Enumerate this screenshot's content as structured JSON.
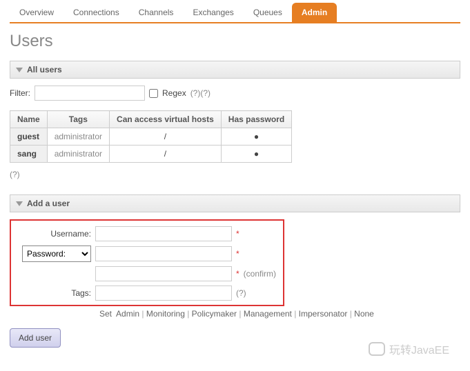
{
  "tabs": [
    "Overview",
    "Connections",
    "Channels",
    "Exchanges",
    "Queues",
    "Admin"
  ],
  "active_tab": "Admin",
  "page_title": "Users",
  "sections": {
    "all_users": "All users",
    "add_user": "Add a user"
  },
  "filter": {
    "label": "Filter:",
    "value": "",
    "regex_label": "Regex",
    "hints": "(?)(?)"
  },
  "table": {
    "headers": [
      "Name",
      "Tags",
      "Can access virtual hosts",
      "Has password"
    ],
    "rows": [
      {
        "name": "guest",
        "tags": "administrator",
        "vhosts": "/",
        "haspw": "●"
      },
      {
        "name": "sang",
        "tags": "administrator",
        "vhosts": "/",
        "haspw": "●"
      }
    ]
  },
  "below_table_hint": "(?)",
  "form": {
    "username_label": "Username:",
    "password_label": "Password:",
    "confirm_label": "(confirm)",
    "tags_label": "Tags:",
    "tags_hint": "(?)",
    "req": "*"
  },
  "set_row": {
    "prefix": "Set",
    "options": [
      "Admin",
      "Monitoring",
      "Policymaker",
      "Management",
      "Impersonator",
      "None"
    ]
  },
  "add_button": "Add user",
  "watermark": "玩转JavaEE"
}
